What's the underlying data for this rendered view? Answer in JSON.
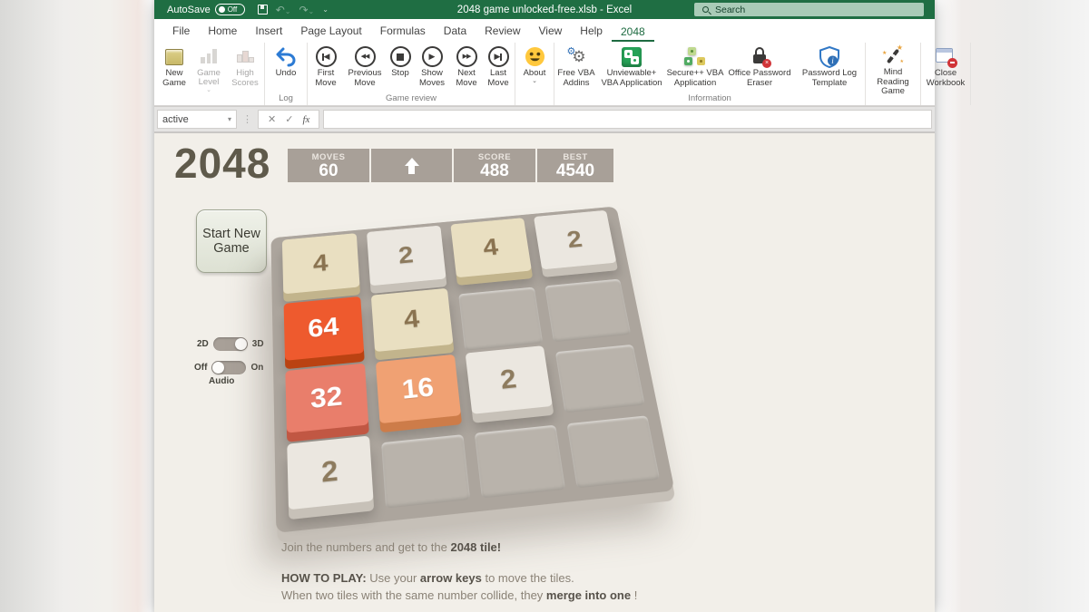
{
  "window": {
    "title": "2048 game unlocked-free.xlsb - Excel",
    "autosave_label": "AutoSave",
    "autosave_state": "Off",
    "search_placeholder": "Search"
  },
  "tabs": {
    "items": [
      "File",
      "Home",
      "Insert",
      "Page Layout",
      "Formulas",
      "Data",
      "Review",
      "View",
      "Help",
      "2048"
    ],
    "active": "2048"
  },
  "ribbon": {
    "groups": [
      {
        "label": "",
        "buttons": [
          {
            "label": "New Game",
            "icon": "new-game-icon"
          },
          {
            "label": "Game Level",
            "icon": "game-level-icon",
            "disabled": true
          },
          {
            "label": "High Scores",
            "icon": "high-scores-icon",
            "disabled": true
          }
        ]
      },
      {
        "label": "Log",
        "buttons": [
          {
            "label": "Undo",
            "icon": "undo-icon"
          }
        ]
      },
      {
        "label": "Game review",
        "buttons": [
          {
            "label": "First Move",
            "icon": "first-move-icon"
          },
          {
            "label": "Previous Move",
            "icon": "previous-move-icon"
          },
          {
            "label": "Stop",
            "icon": "stop-icon"
          },
          {
            "label": "Show Moves",
            "icon": "show-moves-icon"
          },
          {
            "label": "Next Move",
            "icon": "next-move-icon"
          },
          {
            "label": "Last Move",
            "icon": "last-move-icon"
          }
        ]
      },
      {
        "label": "",
        "buttons": [
          {
            "label": "About",
            "icon": "smiley-icon"
          }
        ]
      },
      {
        "label": "Information",
        "buttons": [
          {
            "label": "Free VBA Addins",
            "icon": "gears-icon"
          },
          {
            "label": "Unviewable+ VBA Application",
            "icon": "dice-green-icon"
          },
          {
            "label": "Secure++ VBA Application",
            "icon": "dice-stack-icon"
          },
          {
            "label": "Office Password Eraser",
            "icon": "lock-eraser-icon"
          },
          {
            "label": "Password Log Template",
            "icon": "shield-info-icon"
          }
        ]
      },
      {
        "label": "",
        "buttons": [
          {
            "label": "Mind Reading Game",
            "icon": "magic-wand-icon"
          }
        ]
      },
      {
        "label": "",
        "buttons": [
          {
            "label": "Close Workbook",
            "icon": "close-workbook-icon"
          }
        ]
      }
    ]
  },
  "formula_bar": {
    "name_box": "active",
    "formula": "",
    "fx_label": "fx"
  },
  "game": {
    "title": "2048",
    "scoreboard": {
      "moves_label": "MOVES",
      "moves": "60",
      "arrow": "up",
      "score_label": "SCORE",
      "score": "488",
      "best_label": "BEST",
      "best": "4540"
    },
    "start_button_label": "Start New Game",
    "toggles": {
      "mode": {
        "left": "2D",
        "right": "3D",
        "selected": "3D"
      },
      "audio": {
        "left": "Off",
        "right": "On",
        "selected": "Off",
        "label": "Audio"
      }
    },
    "board": [
      [
        4,
        2,
        4,
        2
      ],
      [
        64,
        4,
        null,
        null
      ],
      [
        32,
        16,
        2,
        null
      ],
      [
        2,
        null,
        null,
        null
      ]
    ],
    "tile_colors": {
      "2": {
        "bg": "#ebe7e0",
        "side": "#c7c1b8",
        "text": "#8d7b5e"
      },
      "4": {
        "bg": "#e9dfc1",
        "side": "#c2b48c",
        "text": "#8a7350"
      },
      "16": {
        "bg": "#f0a173",
        "side": "#cd7c49",
        "text": "#ffffff"
      },
      "32": {
        "bg": "#e97e6b",
        "side": "#c15743",
        "text": "#ffffff"
      },
      "64": {
        "bg": "#ee5a2e",
        "side": "#ba4212",
        "text": "#ffffff"
      },
      "empty": {
        "bg": "#b9b3ab"
      }
    },
    "instructions": {
      "line1": [
        [
          "Join the numbers and get to the ",
          0
        ],
        [
          "2048 tile!",
          1
        ]
      ],
      "line2": [
        [
          "HOW TO PLAY:",
          1
        ],
        [
          " Use your ",
          0
        ],
        [
          "arrow keys",
          1
        ],
        [
          " to move the tiles.",
          0
        ]
      ],
      "line3": [
        [
          "When two tiles with the same number collide, they ",
          0
        ],
        [
          "merge into one",
          1
        ],
        [
          " !",
          0
        ]
      ]
    }
  }
}
